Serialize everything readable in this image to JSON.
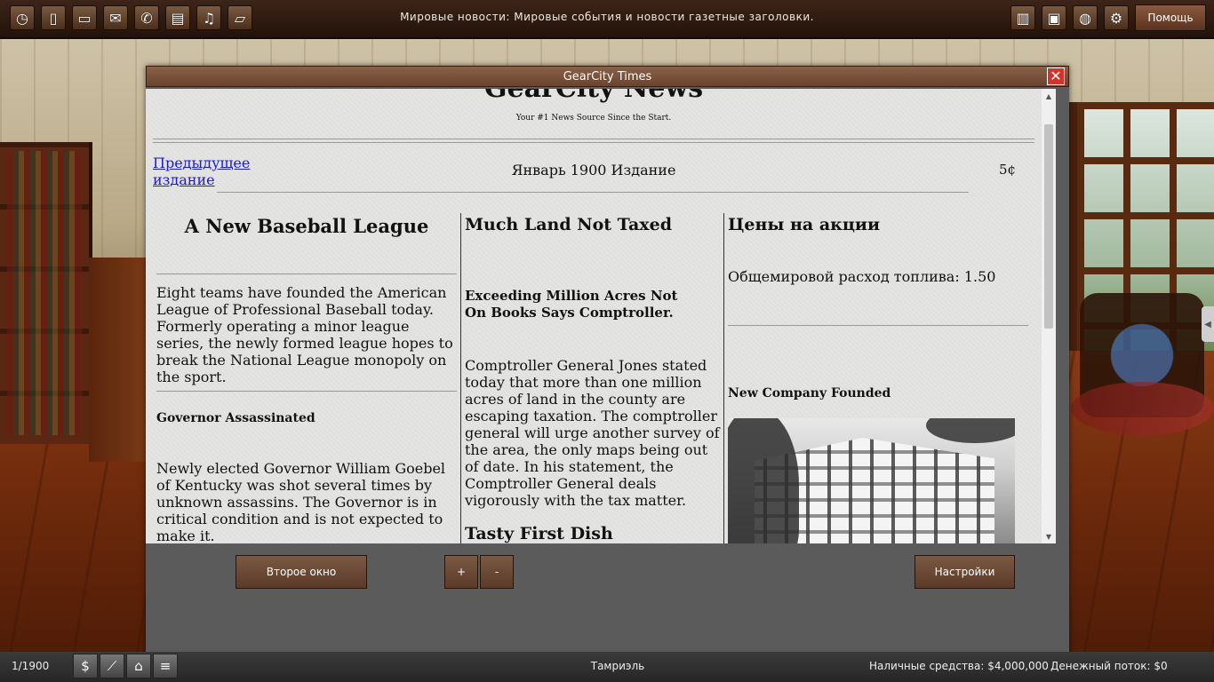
{
  "topbar": {
    "icons": [
      "clock-icon",
      "document-icon",
      "computer-icon",
      "mail-icon",
      "phone-icon",
      "book-icon",
      "music-icon",
      "sewing-machine-icon"
    ],
    "right_icons": [
      "filing-cabinet-icon",
      "safe-icon",
      "globe-icon",
      "gear-icon"
    ],
    "ticker": "Мировые новости: Мировые события и новости газетные заголовки.",
    "help_label": "Помощь"
  },
  "window": {
    "title": "GearCity Times",
    "close_glyph": "✕"
  },
  "paper": {
    "masthead": "GearCity News",
    "tagline": "Your #1 News Source Since the Start.",
    "prev_link": "Предыдущее издание",
    "edition": "Январь 1900 Издание",
    "price": "5¢",
    "col1": {
      "headline": "A New Baseball League",
      "story1": "Eight teams have founded the American League of Professional Baseball today. Formerly operating a minor league series, the newly formed league hopes to break the National League monopoly on the sport.",
      "headline2": "Governor Assassinated",
      "story2": "Newly elected Governor William Goebel of Kentucky was shot several times by unknown assassins. The Governor is in critical condition and is not expected to make it."
    },
    "col2": {
      "headline": "Much Land Not Taxed",
      "subhead": "Exceeding Million Acres Not On Books Says Comptroller.",
      "story": "Comptroller General Jones stated today that more than one million acres of land in the county are escaping taxation. The comptroller general will urge another survey of the area, the only maps being out of date. In his statement, the Comptroller General deals vigorously with the tax matter.",
      "headline2": "Tasty First Dish"
    },
    "col3": {
      "headline": "Цены на акции",
      "fuel": "Общемировой расход топлива: 1.50",
      "headline2": "New Company Founded"
    }
  },
  "controls": {
    "second_window": "Второе окно",
    "zoom_in": "+",
    "zoom_out": "-",
    "settings": "Настройки"
  },
  "bottombar": {
    "date": "1/1900",
    "icons": [
      "dollar-icon",
      "chart-icon",
      "bank-icon",
      "bill-icon"
    ],
    "city": "Тамриэль",
    "cash": "Наличные средства: $4,000,000",
    "cashflow": "Денежный поток: $0"
  }
}
